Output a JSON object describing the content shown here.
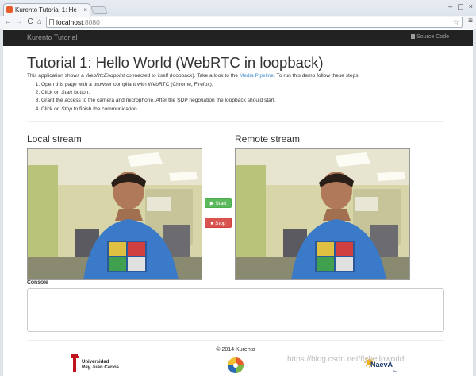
{
  "browser": {
    "tab_title": "Kurento Tutorial 1: He",
    "tab_close": "×",
    "url_host": "localhost",
    "url_port": ":8080",
    "back": "←",
    "forward": "→",
    "reload": "C",
    "home": "⌂",
    "star": "☆",
    "menu": "≡",
    "window_controls": [
      "–",
      "▢",
      "×"
    ]
  },
  "navbar": {
    "brand": "Kurento Tutorial",
    "source_code": "Source Code"
  },
  "page": {
    "title": "Tutorial 1: Hello World (WebRTC in loopback)",
    "intro_part1": "This application shows a ",
    "intro_em": "WebRtcEndpoint",
    "intro_part2": " connected to itself (loopback). Take a look to the ",
    "intro_link": "Media Pipeline",
    "intro_part3": ". To run this demo follow these steps:",
    "steps": [
      {
        "pre": "Open this page with a browser compliant with WebRTC (Chrome, Firefox).",
        "em": "",
        "post": ""
      },
      {
        "pre": "Click on ",
        "em": "Start",
        "post": " button."
      },
      {
        "pre": "Grant the access to the camera and microphone. After the SDP negotiation the loopback should start.",
        "em": "",
        "post": ""
      },
      {
        "pre": "Click on ",
        "em": "Stop",
        "post": " to finish the communication."
      }
    ],
    "local_stream": "Local stream",
    "remote_stream": "Remote stream",
    "start_button": "Start",
    "stop_button": "Stop",
    "console_label": "Console",
    "copyright": "© 2014 Kurento"
  },
  "logos": {
    "urjc_line1": "Universidad",
    "urjc_line2": "Rey Juan Carlos",
    "naeva": "NaevA",
    "naeva_sub": "Tec"
  },
  "watermark": "https://blog.csdn.net/flyhelloworld",
  "colors": {
    "navbar_bg": "#222222",
    "link": "#428bca",
    "start_green": "#5cb85c",
    "stop_red": "#d9534f"
  }
}
